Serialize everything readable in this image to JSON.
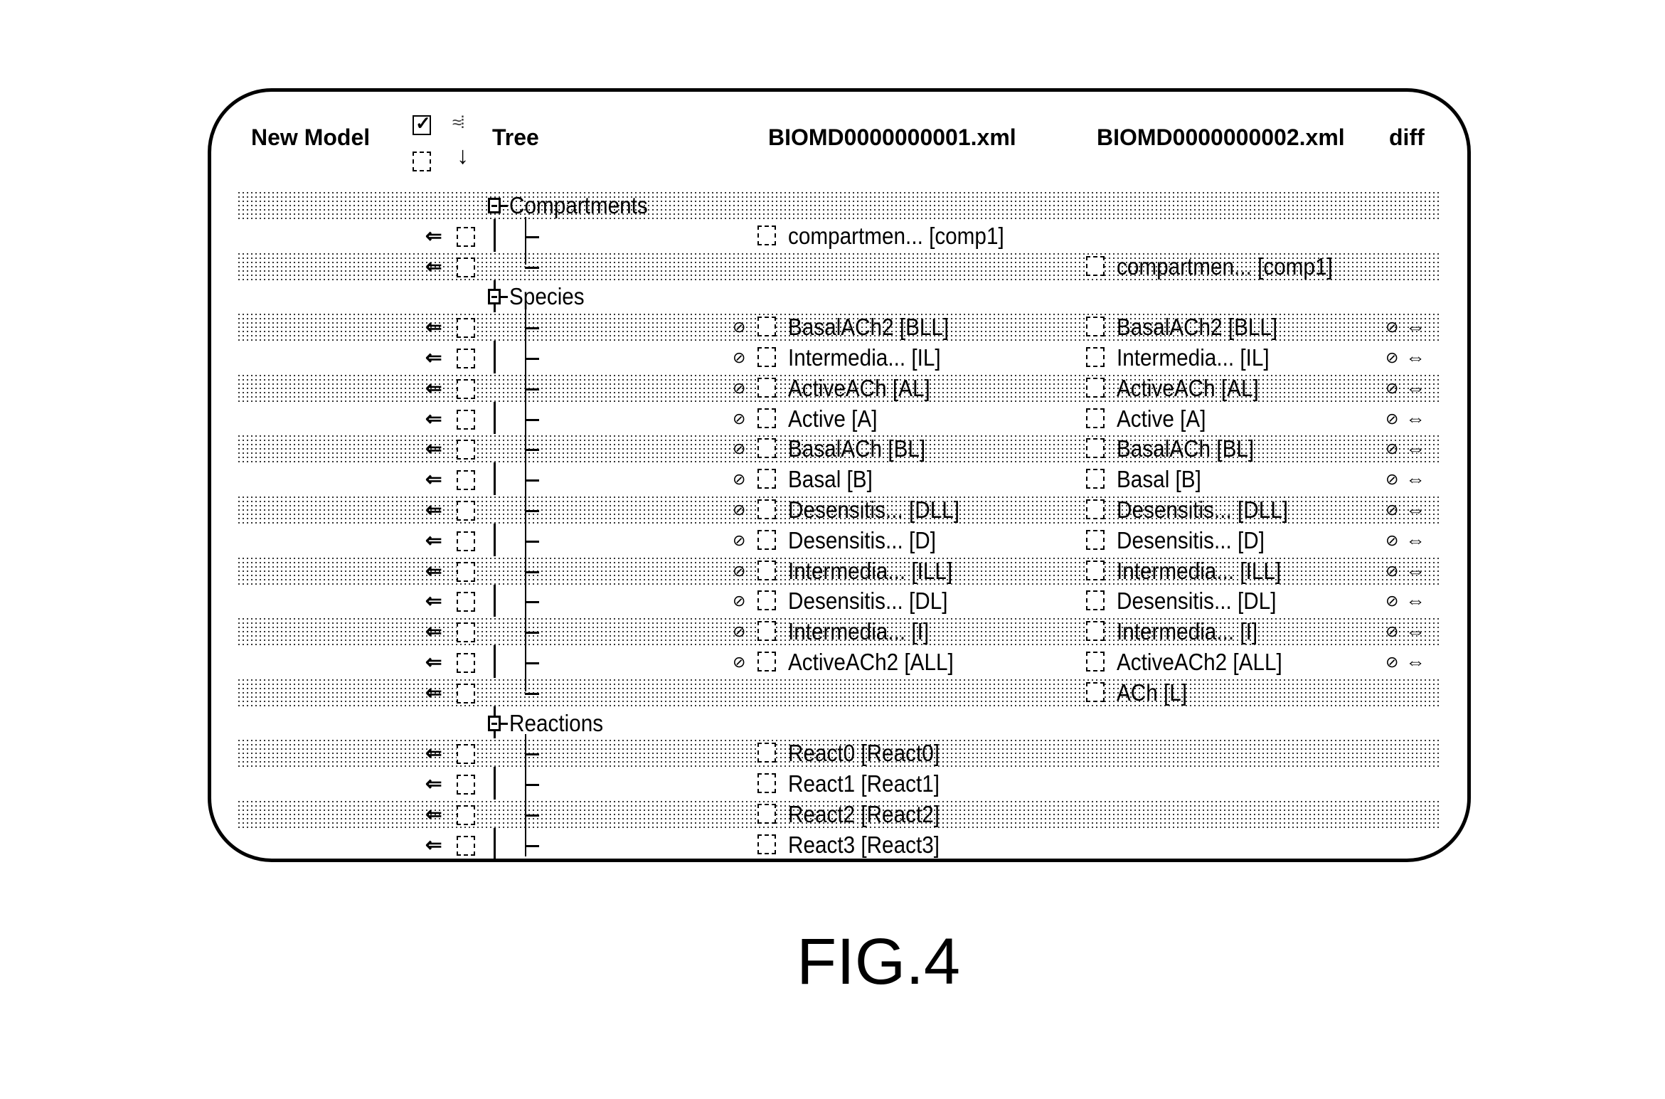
{
  "header": {
    "new_model": "New Model",
    "tree": "Tree",
    "file1": "BIOMD0000000001.xml",
    "file2": "BIOMD0000000002.xml",
    "diff": "diff",
    "checkbox_top_checked": true,
    "checkbox_bottom_checked": false
  },
  "groups": [
    {
      "label": "Compartments",
      "rows": [
        {
          "left": "compartmen... [comp1]",
          "right": "",
          "diff": false
        },
        {
          "left": "",
          "right": "compartmen... [comp1]",
          "diff": false
        }
      ]
    },
    {
      "label": "Species",
      "rows": [
        {
          "left": "BasalACh2 [BLL]",
          "right": "BasalACh2 [BLL]",
          "diff": true
        },
        {
          "left": "Intermedia... [IL]",
          "right": "Intermedia... [IL]",
          "diff": true
        },
        {
          "left": "ActiveACh [AL]",
          "right": "ActiveACh [AL]",
          "diff": true
        },
        {
          "left": "Active [A]",
          "right": "Active [A]",
          "diff": true
        },
        {
          "left": "BasalACh [BL]",
          "right": "BasalACh [BL]",
          "diff": true
        },
        {
          "left": "Basal [B]",
          "right": "Basal [B]",
          "diff": true
        },
        {
          "left": "Desensitis... [DLL]",
          "right": "Desensitis... [DLL]",
          "diff": true
        },
        {
          "left": "Desensitis... [D]",
          "right": "Desensitis... [D]",
          "diff": true
        },
        {
          "left": "Intermedia... [ILL]",
          "right": "Intermedia... [ILL]",
          "diff": true
        },
        {
          "left": "Desensitis... [DL]",
          "right": "Desensitis... [DL]",
          "diff": true
        },
        {
          "left": "Intermedia... [I]",
          "right": "Intermedia... [I]",
          "diff": true
        },
        {
          "left": "ActiveACh2 [ALL]",
          "right": "ActiveACh2 [ALL]",
          "diff": true
        },
        {
          "left": "",
          "right": "ACh [L]",
          "diff": false
        }
      ]
    },
    {
      "label": "Reactions",
      "rows": [
        {
          "left": "React0 [React0]",
          "right": "",
          "diff": false
        },
        {
          "left": "React1 [React1]",
          "right": "",
          "diff": false
        },
        {
          "left": "React2 [React2]",
          "right": "",
          "diff": false
        },
        {
          "left": "React3 [React3]",
          "right": "",
          "diff": false
        }
      ]
    }
  ],
  "icons": {
    "left_arrow": "⇐",
    "right_arrow": "⇔",
    "diff_dot": "⊘",
    "sort_icon": "↓"
  },
  "caption": "FIG.4"
}
